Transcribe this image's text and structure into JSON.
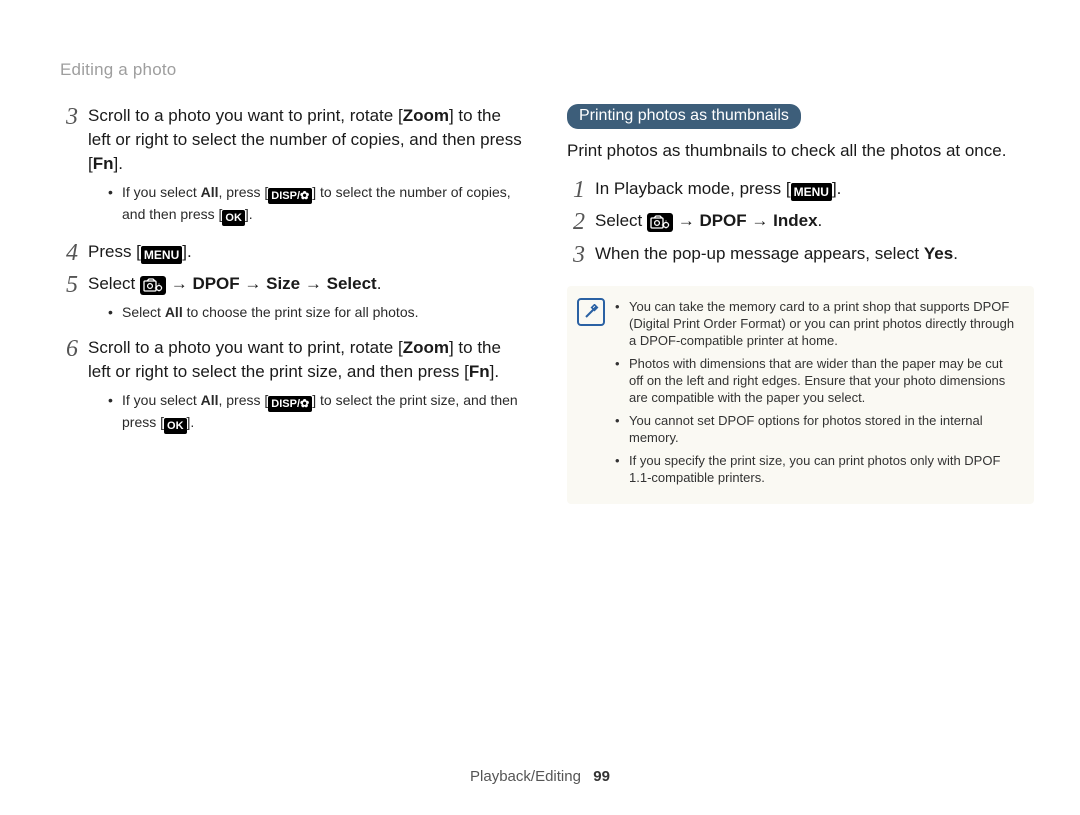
{
  "header": {
    "title": "Editing a photo"
  },
  "left": {
    "step3": {
      "num": "3",
      "l1a": "Scroll to a photo you want to print, rotate [",
      "l1b": "Zoom",
      "l1c": "] to the left or right to select the number of copies, and then press [",
      "l1d": "Fn",
      "l1e": "].",
      "bullet1a": "If you select ",
      "bullet1b": "All",
      "bullet1c": ", press [",
      "tok_disp": "DISP",
      "tok_flower": "✿",
      "bullet1d": "] to select the number of copies, and then press [",
      "tok_ok": "OK",
      "bullet1e": "]."
    },
    "step4": {
      "num": "4",
      "a": "Press [",
      "menu": "MENU",
      "b": "]."
    },
    "step5": {
      "num": "5",
      "a": "Select ",
      "b": " → ",
      "dpof": "DPOF",
      "c": " → ",
      "size": "Size",
      "d": " → ",
      "select": "Select",
      "e": ".",
      "bullet1a": "Select ",
      "bullet1b": "All",
      "bullet1c": " to choose the print size for all photos."
    },
    "step6": {
      "num": "6",
      "a": "Scroll to a photo you want to print, rotate [",
      "b": "Zoom",
      "c": "] to the left or right to select the print size, and then press [",
      "d": "Fn",
      "e": "].",
      "bullet1a": "If you select ",
      "bullet1b": "All",
      "bullet1c": ", press [",
      "tok_disp": "DISP",
      "tok_flower": "✿",
      "bullet1d": "] to select the print size, and then press [",
      "tok_ok": "OK",
      "bullet1e": "]."
    }
  },
  "right": {
    "pill": "Printing photos as thumbnails",
    "intro": "Print photos as thumbnails to check all the photos at once.",
    "step1": {
      "num": "1",
      "a": "In Playback mode, press [",
      "menu": "MENU",
      "b": "]."
    },
    "step2": {
      "num": "2",
      "a": "Select ",
      "b": " → ",
      "dpof": "DPOF",
      "c": " → ",
      "index": "Index",
      "d": "."
    },
    "step3": {
      "num": "3",
      "a": "When the pop-up message appears, select ",
      "yes": "Yes",
      "b": "."
    },
    "notes": {
      "n1": "You can take the memory card to a print shop that supports DPOF (Digital Print Order Format) or you can print photos directly through a DPOF-compatible printer at home.",
      "n2": "Photos with dimensions that are wider than the paper may be cut off on the left and right edges. Ensure that your photo dimensions are compatible with the paper you select.",
      "n3": "You cannot set DPOF options for photos stored in the internal memory.",
      "n4": "If you specify the print size, you can print photos only with DPOF 1.1-compatible printers."
    }
  },
  "footer": {
    "section": "Playback/Editing",
    "page": "99"
  }
}
